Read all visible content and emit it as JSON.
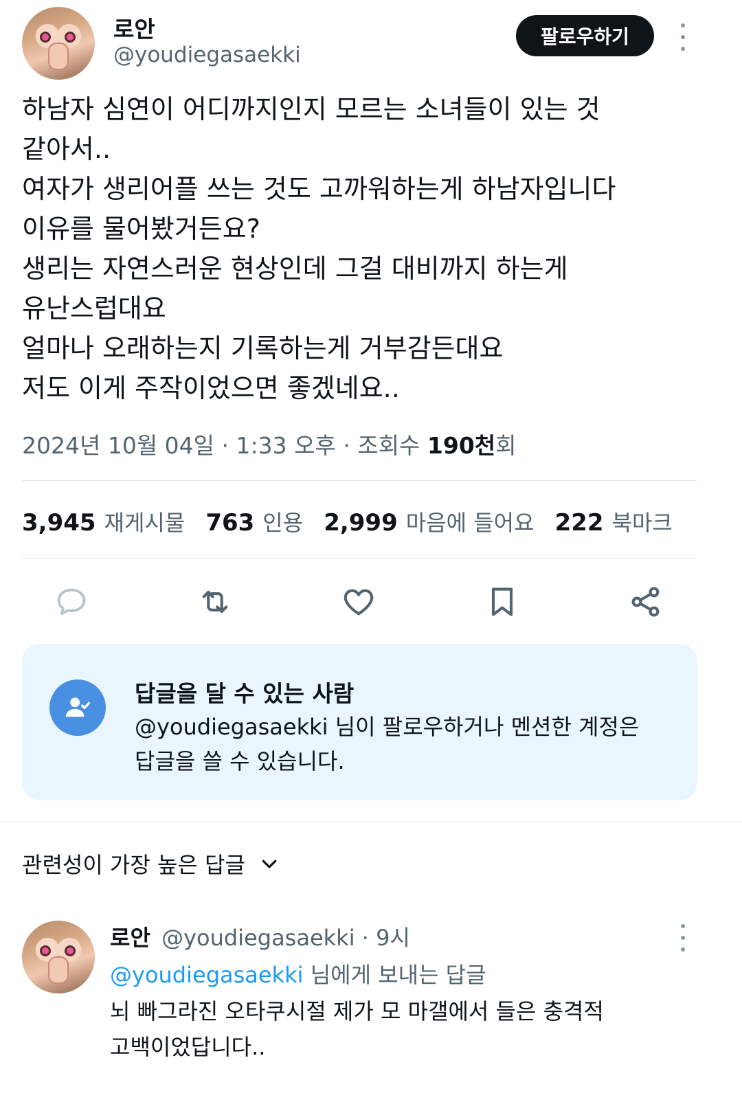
{
  "tweet": {
    "author": {
      "name": "로안",
      "handle": "@youdiegasaekki"
    },
    "follow_label": "팔로우하기",
    "text_lines": [
      "하남자 심연이 어디까지인지 모르는 소녀들이 있는 것",
      "같아서..",
      "여자가 생리어플 쓰는 것도 고까워하는게 하남자입니다",
      "이유를 물어봤거든요?",
      "생리는 자연스러운 현상인데 그걸 대비까지 하는게",
      "유난스럽대요",
      "얼마나 오래하는지 기록하는게 거부감든대요",
      "저도 이게 주작이었으면 좋겠네요.."
    ],
    "meta": {
      "date": "2024년 10월 04일",
      "sep1": " · ",
      "time": "1:33 오후",
      "sep2": " · ",
      "views_prefix": "조회수 ",
      "views_value": "190천",
      "views_suffix": "회"
    },
    "stats": {
      "retweets": {
        "count": "3,945",
        "label": "재게시물"
      },
      "quotes": {
        "count": "763",
        "label": "인용"
      },
      "likes": {
        "count": "2,999",
        "label": "마음에 들어요"
      },
      "bookmarks": {
        "count": "222",
        "label": "북마크"
      }
    },
    "actions": [
      "reply-icon",
      "retweet-icon",
      "like-icon",
      "bookmark-icon",
      "share-icon"
    ]
  },
  "reply_permission": {
    "title": "답글을 달 수 있는 사람",
    "desc_lines": [
      "@youdiegasaekki 님이 팔로우하거나 멘션한 계정은",
      "답글을 쓸 수 있습니다."
    ]
  },
  "sort": {
    "label": "관련성이 가장 높은 답글"
  },
  "reply": {
    "name": "로안",
    "handle": "@youdiegasaekki",
    "time": " · 9시",
    "reply_to_mention": "@youdiegasaekki",
    "reply_to_rest": " 님에게 보내는 답글",
    "text_lines": [
      "뇌 빠그라진 오타쿠시절 제가 모 마갤에서 들은 충격적",
      "고백이었답니다.."
    ]
  },
  "colors": {
    "text": "#0f1419",
    "secondary": "#536471",
    "accent": "#1d9bf0",
    "card_bg": "#eaf6fd",
    "perm_icon_bg": "#4a90e2"
  }
}
